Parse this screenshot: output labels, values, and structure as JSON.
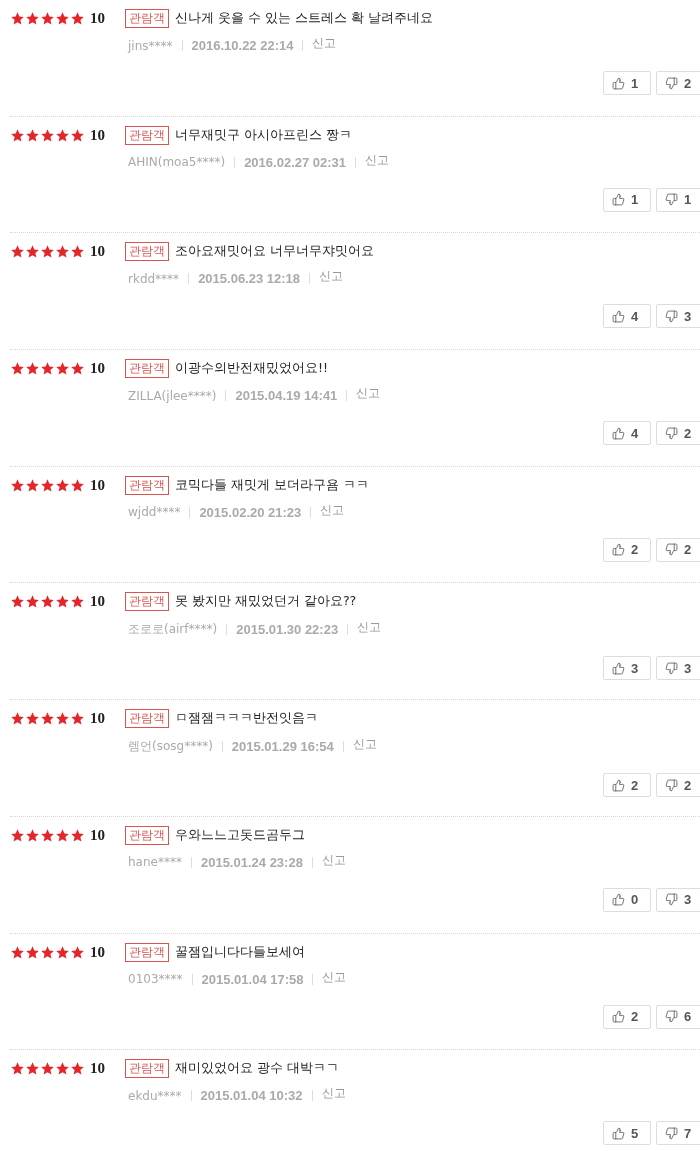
{
  "reviews": [
    {
      "stars": 5,
      "score": "10",
      "badge": "관람객",
      "comment": "신나게 웃을 수 있는 스트레스 확 날려주네요",
      "user": "jins****",
      "date": "2016.10.22 22:14",
      "report": "신고",
      "likes": "1",
      "dislikes": "2"
    },
    {
      "stars": 5,
      "score": "10",
      "badge": "관람객",
      "comment": "너무재밋구 아시아프린스 짱ㅋ",
      "user": "AHIN(moa5****)",
      "date": "2016.02.27 02:31",
      "report": "신고",
      "likes": "1",
      "dislikes": "1"
    },
    {
      "stars": 5,
      "score": "10",
      "badge": "관람객",
      "comment": "조아요재밋어요 너무너무쟈밋어요",
      "user": "rkdd****",
      "date": "2015.06.23 12:18",
      "report": "신고",
      "likes": "4",
      "dislikes": "3"
    },
    {
      "stars": 5,
      "score": "10",
      "badge": "관람객",
      "comment": "이광수의반전재밌었어요!!",
      "user": "ZILLA(jlee****)",
      "date": "2015.04.19 14:41",
      "report": "신고",
      "likes": "4",
      "dislikes": "2"
    },
    {
      "stars": 5,
      "score": "10",
      "badge": "관람객",
      "comment": "코믹다들 재밋게 보더라구욤 ㅋㅋ",
      "user": "wjdd****",
      "date": "2015.02.20 21:23",
      "report": "신고",
      "likes": "2",
      "dislikes": "2"
    },
    {
      "stars": 5,
      "score": "10",
      "badge": "관람객",
      "comment": "못 봤지만 재밌었던거 같아요??",
      "user": "조로로(airf****)",
      "date": "2015.01.30 22:23",
      "report": "신고",
      "likes": "3",
      "dislikes": "3"
    },
    {
      "stars": 5,
      "score": "10",
      "badge": "관람객",
      "comment": "ㅁ잼잼ㅋㅋㅋ반전잇음ㅋ",
      "user": "렘언(sosg****)",
      "date": "2015.01.29 16:54",
      "report": "신고",
      "likes": "2",
      "dislikes": "2"
    },
    {
      "stars": 5,
      "score": "10",
      "badge": "관람객",
      "comment": "우와느느고돗드곰두그",
      "user": "hane****",
      "date": "2015.01.24 23:28",
      "report": "신고",
      "likes": "0",
      "dislikes": "3"
    },
    {
      "stars": 5,
      "score": "10",
      "badge": "관람객",
      "comment": "꿀잼입니다다들보세여",
      "user": "0103****",
      "date": "2015.01.04 17:58",
      "report": "신고",
      "likes": "2",
      "dislikes": "6"
    },
    {
      "stars": 5,
      "score": "10",
      "badge": "관람객",
      "comment": "재미있었어요 광수 대박ㅋㄱ",
      "user": "ekdu****",
      "date": "2015.01.04 10:32",
      "report": "신고",
      "likes": "5",
      "dislikes": "7"
    }
  ]
}
